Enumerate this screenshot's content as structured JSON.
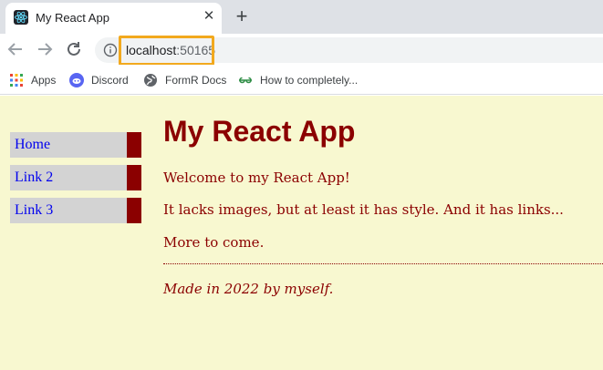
{
  "browser": {
    "tab": {
      "title": "My React App",
      "close_symbol": "✕"
    },
    "new_tab_symbol": "+",
    "address": {
      "host": "localhost",
      "port": ":50165"
    },
    "bookmarks": [
      {
        "label": "Apps",
        "icon": "apps-grid-icon"
      },
      {
        "label": "Discord",
        "icon": "discord-icon"
      },
      {
        "label": "FormR Docs",
        "icon": "globe-icon"
      },
      {
        "label": "How to completely...",
        "icon": "geeksforgeeks-icon"
      }
    ],
    "highlight_color": "#f2a91e"
  },
  "page": {
    "nav": [
      {
        "label": "Home"
      },
      {
        "label": "Link 2"
      },
      {
        "label": "Link 3"
      }
    ],
    "heading": "My React App",
    "paragraphs": [
      "Welcome to my React App!",
      "It lacks images, but at least it has style. And it has links...",
      "More to come."
    ],
    "footer": "Made in 2022 by myself.",
    "colors": {
      "background": "#f8f8d0",
      "text": "#8b0000",
      "nav_bg": "#d3d3d3",
      "link": "#0000ee"
    }
  }
}
